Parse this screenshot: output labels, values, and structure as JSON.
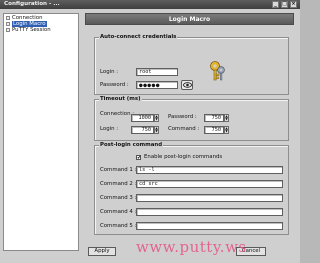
{
  "window": {
    "title": "Configuration - ...",
    "controls": [
      "_",
      "□",
      "×"
    ]
  },
  "tree": {
    "items": [
      {
        "label": "Connection",
        "selected": false
      },
      {
        "label": "Login Macro",
        "selected": true
      },
      {
        "label": "PuTTY Session",
        "selected": false
      }
    ]
  },
  "header": {
    "title": "Login Macro"
  },
  "credentials": {
    "title": "Auto-connect credentials",
    "login_label": "Login :",
    "login_value": "root",
    "password_label": "Password :",
    "password_mask": "●●●●●",
    "icons": {
      "reveal": "eye-icon",
      "keys": "keys-icon"
    }
  },
  "timeout": {
    "title": "Timeout (ms)",
    "connection_label": "Connection :",
    "connection_value": "1000",
    "password_label": "Password :",
    "password_value": "750",
    "login_label": "Login :",
    "login_value": "750",
    "command_label": "Command :",
    "command_value": "750"
  },
  "post_login": {
    "title": "Post-login command",
    "enable_label": "Enable post-login commands",
    "enable_checked": true,
    "enable_mark": "✔",
    "commands": [
      {
        "label": "Command 1 :",
        "value": "ls -l"
      },
      {
        "label": "Command 2 :",
        "value": "cd src"
      },
      {
        "label": "Command 3 :",
        "value": ""
      },
      {
        "label": "Command 4 :",
        "value": ""
      },
      {
        "label": "Command 5 :",
        "value": ""
      }
    ]
  },
  "buttons": {
    "apply": "Apply",
    "cancel": "Cancel"
  },
  "watermark": "www.putty.ws",
  "colors": {
    "header_bg": "#666666",
    "selection": "#2f5fb4",
    "watermark": "#e55b8a"
  }
}
